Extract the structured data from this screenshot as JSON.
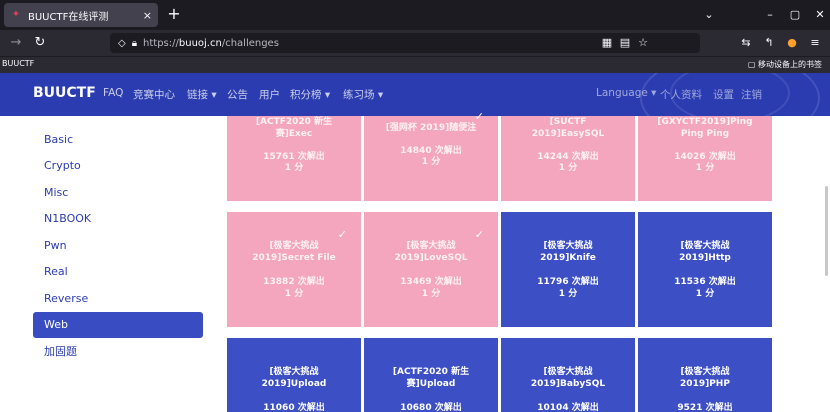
{
  "browser": {
    "tab_title": "BUUCTF在线评测",
    "tab_close": "×",
    "new_tab": "+",
    "url_prefix": "https://",
    "url_host": "buuoj.cn",
    "url_path": "/challenges",
    "bookmark_left": "BUUCTF",
    "bookmark_right": "移动设备上的书签",
    "window_controls": [
      "⌄",
      "–",
      "▢",
      "✕"
    ]
  },
  "site": {
    "brand": "BUUCTF",
    "nav_links": [
      "FAQ",
      "竞赛中心",
      "链接",
      "公告",
      "用户",
      "积分榜",
      "练习场"
    ],
    "nav_right": [
      "Language",
      "个人资料",
      "设置",
      "注销"
    ]
  },
  "sidebar": {
    "items": [
      "Basic",
      "Crypto",
      "Misc",
      "N1BOOK",
      "Pwn",
      "Real",
      "Reverse",
      "Web",
      "加固题"
    ],
    "active": "Web"
  },
  "challenges": [
    {
      "title1": "[ACTF2020 新生",
      "title2": "赛]Exec",
      "solves": "15761 次解出",
      "score": "1 分",
      "solved": true
    },
    {
      "title1": "[强网杯 2019]随便注",
      "title2": "",
      "solves": "14840 次解出",
      "score": "1 分",
      "solved": true
    },
    {
      "title1": "[SUCTF",
      "title2": "2019]EasySQL",
      "solves": "14244 次解出",
      "score": "1 分",
      "solved": true
    },
    {
      "title1": "[GXYCTF2019]Ping",
      "title2": "Ping Ping",
      "solves": "14026 次解出",
      "score": "1 分",
      "solved": true
    },
    {
      "title1": "[极客大挑战",
      "title2": "2019]Secret File",
      "solves": "13882 次解出",
      "score": "1 分",
      "solved": true
    },
    {
      "title1": "[极客大挑战",
      "title2": "2019]LoveSQL",
      "solves": "13469 次解出",
      "score": "1 分",
      "solved": true
    },
    {
      "title1": "[极客大挑战",
      "title2": "2019]Knife",
      "solves": "11796 次解出",
      "score": "1 分",
      "solved": false
    },
    {
      "title1": "[极客大挑战",
      "title2": "2019]Http",
      "solves": "11536 次解出",
      "score": "1 分",
      "solved": false
    },
    {
      "title1": "[极客大挑战",
      "title2": "2019]Upload",
      "solves": "11060 次解出",
      "score": "",
      "solved": false
    },
    {
      "title1": "[ACTF2020 新生",
      "title2": "赛]Upload",
      "solves": "10680 次解出",
      "score": "",
      "solved": false
    },
    {
      "title1": "[极客大挑战",
      "title2": "2019]BabySQL",
      "solves": "10104 次解出",
      "score": "",
      "solved": false
    },
    {
      "title1": "[极客大挑战",
      "title2": "2019]PHP",
      "solves": "9521 次解出",
      "score": "",
      "solved": false
    }
  ],
  "check_mark": "✓",
  "colors": {
    "brand_blue": "#2b3cb0",
    "solved": "#f4a6be",
    "unsolved": "#3d4fc5"
  }
}
